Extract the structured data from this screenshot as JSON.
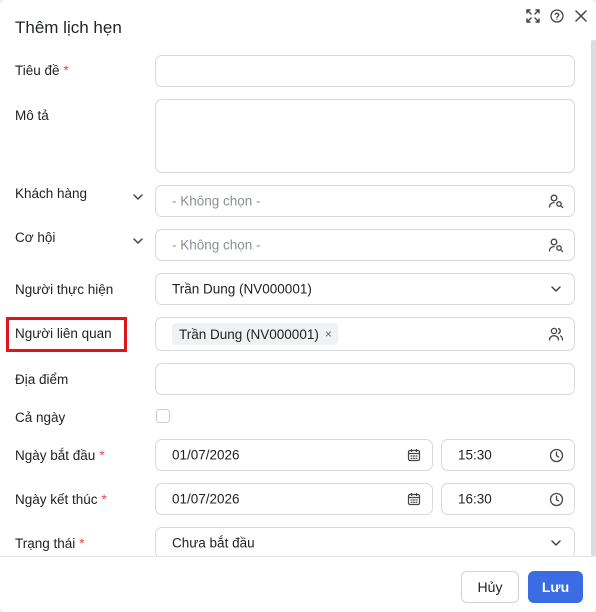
{
  "dialog": {
    "title": "Thêm lịch hẹn",
    "header_icons": [
      "expand-icon",
      "help-icon",
      "close-icon"
    ]
  },
  "form": {
    "title": {
      "label": "Tiêu đề",
      "required_mark": "*",
      "value": ""
    },
    "description": {
      "label": "Mô tả",
      "value": ""
    },
    "customer": {
      "label": "Khách hàng",
      "placeholder": "- Không chọn -"
    },
    "opportunity": {
      "label": "Cơ hội",
      "placeholder": "- Không chọn -"
    },
    "assignee": {
      "label": "Người thực hiện",
      "value": "Trần Dung (NV000001)"
    },
    "related": {
      "label": "Người liên quan",
      "chips": [
        "Trần Dung (NV000001)"
      ],
      "chip_remove": "×"
    },
    "location": {
      "label": "Địa điểm",
      "value": ""
    },
    "all_day": {
      "label": "Cả ngày",
      "checked": false
    },
    "start": {
      "label": "Ngày bắt đầu",
      "required_mark": "*",
      "date": "01/07/2026",
      "time": "15:30"
    },
    "end": {
      "label": "Ngày kết thúc",
      "required_mark": "*",
      "date": "01/07/2026",
      "time": "16:30"
    },
    "status": {
      "label": "Trạng thái",
      "required_mark": "*",
      "value": "Chưa bắt đầu"
    }
  },
  "footer": {
    "cancel_label": "Hủy",
    "save_label": "Lưu"
  },
  "colors": {
    "accent": "#3b6ce3",
    "required": "#e5484d",
    "highlight": "#e0141b"
  }
}
